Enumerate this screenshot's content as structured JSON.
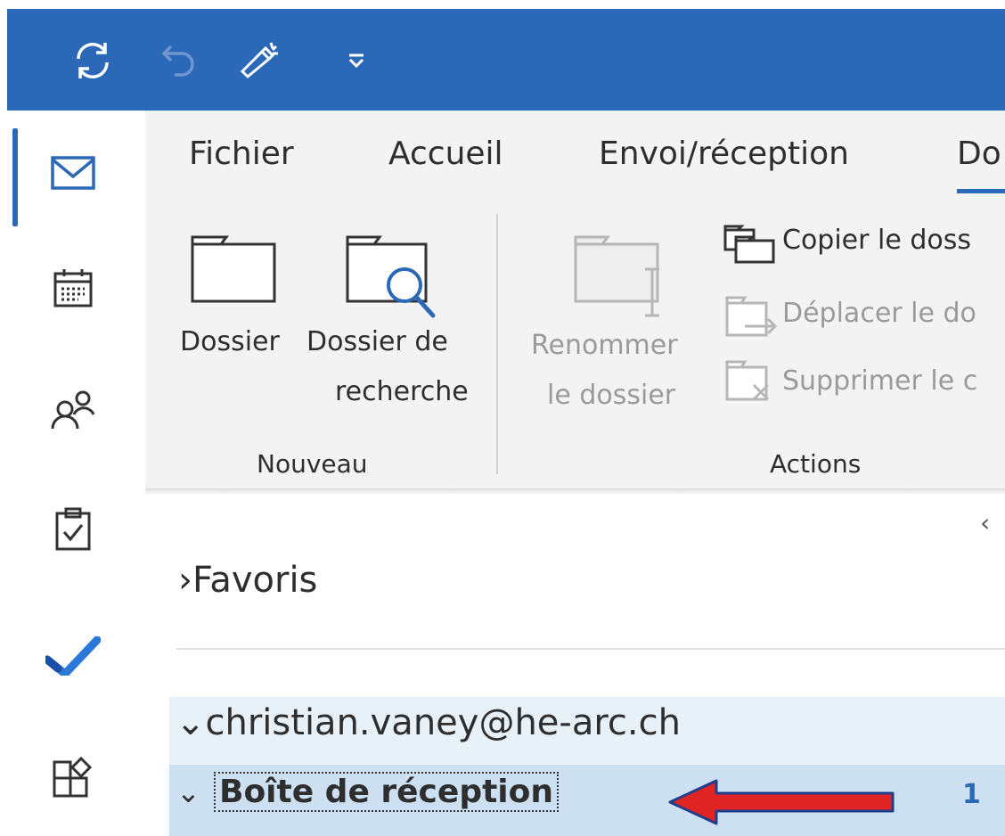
{
  "quick_access": {
    "icons": [
      "sync-icon",
      "undo-icon",
      "brush-icon",
      "customize-dropdown-icon"
    ]
  },
  "left_nav": {
    "items": [
      "mail-icon",
      "calendar-icon",
      "people-icon",
      "tasks-icon",
      "todo-check-icon",
      "apps-icon"
    ],
    "active": "mail-icon"
  },
  "ribbon": {
    "tabs": [
      "Fichier",
      "Accueil",
      "Envoi/réception",
      "Do"
    ],
    "active_tab": "Do",
    "groups": {
      "nouveau": {
        "label": "Nouveau",
        "dossier": "Dossier",
        "dossier_recherche_1": "Dossier de",
        "dossier_recherche_2": "recherche"
      },
      "actions": {
        "label": "Actions",
        "renommer_1": "Renommer",
        "renommer_2": "le dossier",
        "copier": "Copier le doss",
        "deplacer": "Déplacer le do",
        "supprimer": "Supprimer le c"
      }
    }
  },
  "folders": {
    "favoris": "Favoris",
    "account": "christian.vaney@he-arc.ch",
    "inbox": "Boîte de réception",
    "inbox_count": "1"
  },
  "colors": {
    "accent": "#2b68b8",
    "arrow_red": "#e02424",
    "arrow_border": "#1f3f8a"
  }
}
